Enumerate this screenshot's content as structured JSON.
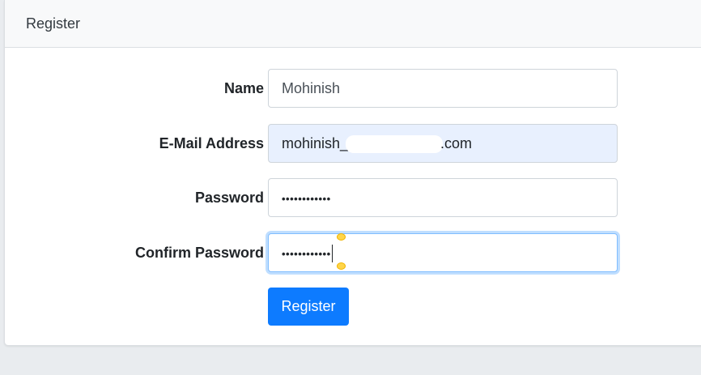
{
  "card": {
    "title": "Register"
  },
  "form": {
    "name_label": "Name",
    "name_value": "Mohinish",
    "email_label": "E-Mail Address",
    "email_prefix": "mohinish_",
    "email_suffix": ".com",
    "password_label": "Password",
    "password_mask": "••••••••••••",
    "confirm_label": "Confirm Password",
    "confirm_mask": "••••••••••••",
    "submit_label": "Register"
  },
  "colors": {
    "accent": "#0d7bff",
    "autofill_bg": "#e8f0fe",
    "focus_border": "#80bdff"
  }
}
